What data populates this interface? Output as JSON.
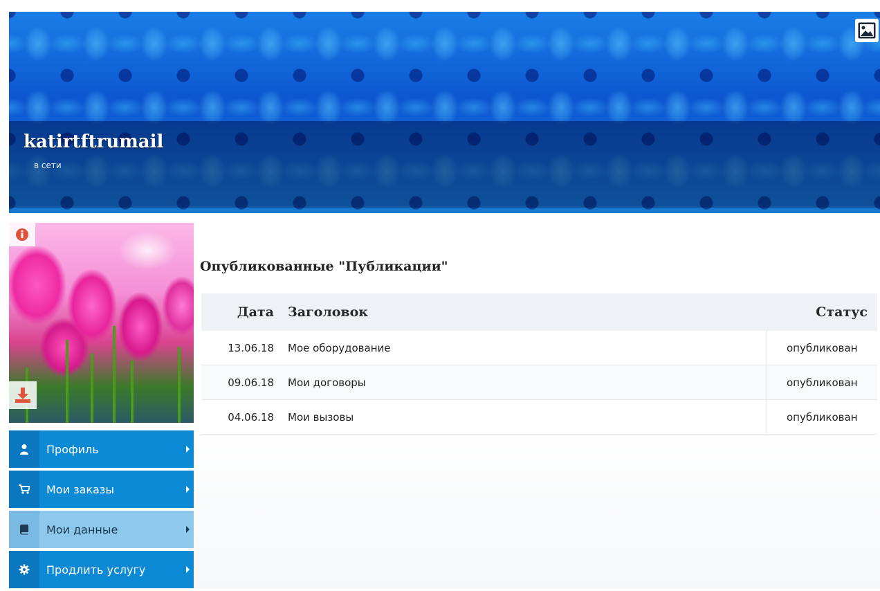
{
  "header": {
    "username": "katirtftrumail",
    "status": "в сети",
    "cover_icon": "image-icon"
  },
  "avatar": {
    "info_icon": "info-icon",
    "download_icon": "download-icon"
  },
  "sidebar": {
    "items": [
      {
        "label": "Профиль",
        "icon": "user-icon"
      },
      {
        "label": "Мои заказы",
        "icon": "cart-icon"
      },
      {
        "label": "Мои данные",
        "icon": "book-icon"
      },
      {
        "label": "Продлить услугу",
        "icon": "gear-icon"
      }
    ]
  },
  "main": {
    "title": "Опубликованные \"Публикации\"",
    "table": {
      "columns": [
        "Дата",
        "Заголовок",
        "Статус"
      ],
      "rows": [
        {
          "date": "13.06.18",
          "title": "Мое оборудование",
          "status": "опубликован"
        },
        {
          "date": "09.06.18",
          "title": "Мои договоры",
          "status": "опубликован"
        },
        {
          "date": "04.06.18",
          "title": "Мои вызовы",
          "status": "опубликован"
        }
      ]
    }
  },
  "colors": {
    "menu_blue": "#0d8ad6",
    "menu_active": "#8ec8ec",
    "accent_red": "#e0533c"
  }
}
